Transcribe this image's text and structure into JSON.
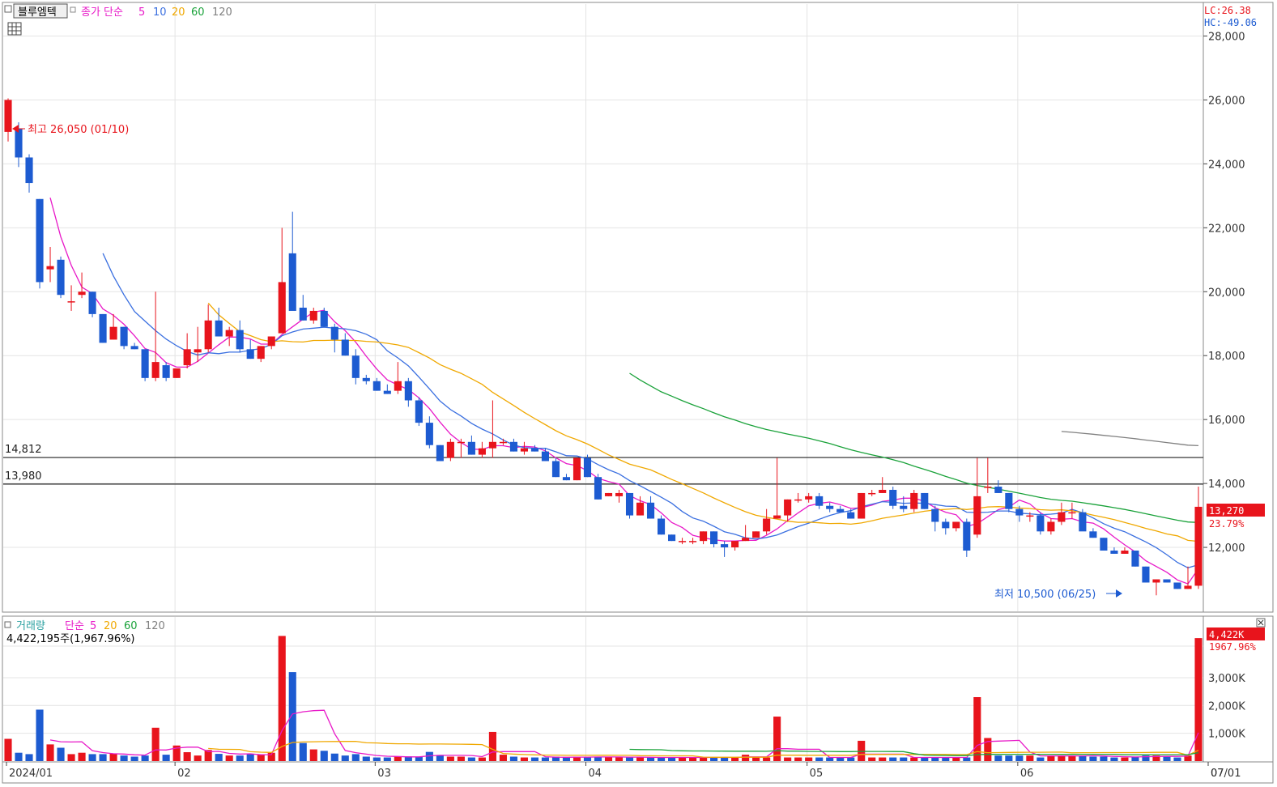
{
  "stock_name": "블루엠텍",
  "legend_price": {
    "title": "종가 단순",
    "ma": [
      {
        "label": "5",
        "color": "#e819c8"
      },
      {
        "label": "10",
        "color": "#3a6fe0"
      },
      {
        "label": "20",
        "color": "#f0a800"
      },
      {
        "label": "60",
        "color": "#1aa23a"
      },
      {
        "label": "120",
        "color": "#808080"
      }
    ]
  },
  "legend_volume": {
    "title": "거래량",
    "sub": "단순",
    "ma": [
      {
        "label": "5",
        "color": "#e819c8"
      },
      {
        "label": "20",
        "color": "#f0a800"
      },
      {
        "label": "60",
        "color": "#1aa23a"
      },
      {
        "label": "120",
        "color": "#808080"
      }
    ]
  },
  "volume_readout": "4,422,195주(1,967.96%)",
  "lc_readout": "LC:26.38",
  "hc_readout": "HC:-49.06",
  "high_annotation": "최고 26,050 (01/10)",
  "low_annotation": "최저 10,500 (06/25)",
  "hlines": [
    {
      "label": "14,812",
      "value": 14812
    },
    {
      "label": "13,980",
      "value": 13980
    }
  ],
  "current_price_label": "13,270",
  "current_change_label": "23.79%",
  "current_volume_label": "4,422K",
  "current_volume_change_label": "1967.96%",
  "colors": {
    "up": "#e8141c",
    "down": "#1d5bd1",
    "grid": "#e4e4e4"
  },
  "chart_data": {
    "type": "candlestick",
    "price_axis": {
      "ylim": [
        10000,
        29000
      ],
      "ticks": [
        {
          "value": 12000,
          "label": "12,000"
        },
        {
          "value": 14000,
          "label": "14,000"
        },
        {
          "value": 16000,
          "label": "16,000"
        },
        {
          "value": 18000,
          "label": "18,000"
        },
        {
          "value": 20000,
          "label": "20,000"
        },
        {
          "value": 22000,
          "label": "22,000"
        },
        {
          "value": 24000,
          "label": "24,000"
        },
        {
          "value": 26000,
          "label": "26,000"
        },
        {
          "value": 28000,
          "label": "28,000"
        }
      ]
    },
    "volume_axis": {
      "ylim": [
        0,
        4600
      ],
      "unit": "K",
      "ticks": [
        {
          "value": 1000,
          "label": "1,000K"
        },
        {
          "value": 2000,
          "label": "2,000K"
        },
        {
          "value": 3000,
          "label": "3,000K"
        }
      ]
    },
    "x_ticks": [
      {
        "index": 0,
        "label": "2024/01"
      },
      {
        "index": 16,
        "label": "02"
      },
      {
        "index": 35,
        "label": "03"
      },
      {
        "index": 55,
        "label": "04"
      },
      {
        "index": 76,
        "label": "05"
      },
      {
        "index": 96,
        "label": "06"
      },
      {
        "index": 115,
        "label": "07"
      },
      {
        "index": 120,
        "label": "07/01"
      }
    ],
    "candles": [
      [
        25000,
        26050,
        24700,
        26000,
        800
      ],
      [
        25100,
        25300,
        23900,
        24200,
        300
      ],
      [
        24200,
        24300,
        23100,
        23400,
        250
      ],
      [
        22900,
        22900,
        20100,
        20300,
        1850
      ],
      [
        20700,
        21400,
        20300,
        20800,
        600
      ],
      [
        21000,
        21100,
        19800,
        19900,
        480
      ],
      [
        19700,
        20200,
        19400,
        19700,
        250
      ],
      [
        19900,
        20600,
        19800,
        20000,
        300
      ],
      [
        20000,
        20000,
        19200,
        19300,
        250
      ],
      [
        19300,
        19300,
        18400,
        18400,
        250
      ],
      [
        18500,
        19300,
        18500,
        18900,
        270
      ],
      [
        18900,
        18900,
        18200,
        18300,
        200
      ],
      [
        18300,
        18400,
        18200,
        18200,
        160
      ],
      [
        18200,
        18200,
        17200,
        17300,
        200
      ],
      [
        17300,
        20000,
        17200,
        17800,
        1200
      ],
      [
        17700,
        17800,
        17200,
        17300,
        230
      ],
      [
        17300,
        17600,
        17300,
        17600,
        560
      ],
      [
        17700,
        18700,
        17600,
        18200,
        320
      ],
      [
        18100,
        18900,
        17800,
        18200,
        200
      ],
      [
        18200,
        19600,
        18100,
        19100,
        400
      ],
      [
        19100,
        19500,
        18900,
        18600,
        260
      ],
      [
        18600,
        18900,
        18300,
        18800,
        200
      ],
      [
        18800,
        19100,
        18100,
        18200,
        200
      ],
      [
        18200,
        18500,
        17900,
        17900,
        250
      ],
      [
        17900,
        18300,
        17800,
        18300,
        220
      ],
      [
        18300,
        18600,
        18200,
        18600,
        300
      ],
      [
        18700,
        22000,
        18700,
        20300,
        4500
      ],
      [
        21200,
        22500,
        19700,
        19400,
        3200
      ],
      [
        19500,
        19900,
        19100,
        19100,
        650
      ],
      [
        19100,
        19500,
        19000,
        19400,
        420
      ],
      [
        19400,
        19500,
        18900,
        18900,
        370
      ],
      [
        18900,
        19000,
        18100,
        18500,
        270
      ],
      [
        18500,
        18700,
        18000,
        18000,
        200
      ],
      [
        18000,
        18200,
        17100,
        17300,
        250
      ],
      [
        17300,
        17400,
        17100,
        17200,
        160
      ],
      [
        17200,
        17300,
        16900,
        16900,
        130
      ],
      [
        16900,
        17100,
        16800,
        16800,
        130
      ],
      [
        16900,
        17800,
        16800,
        17200,
        160
      ],
      [
        17200,
        17300,
        16400,
        16600,
        170
      ],
      [
        16600,
        16700,
        15800,
        15900,
        160
      ],
      [
        15900,
        16100,
        15100,
        15200,
        330
      ],
      [
        15200,
        15200,
        14700,
        14700,
        220
      ],
      [
        14800,
        15400,
        14700,
        15300,
        160
      ],
      [
        15300,
        15400,
        14800,
        15300,
        160
      ],
      [
        15300,
        15500,
        14900,
        14900,
        130
      ],
      [
        14900,
        15300,
        14800,
        15100,
        130
      ],
      [
        15100,
        16600,
        14800,
        15300,
        1050
      ],
      [
        15300,
        15400,
        15200,
        15300,
        230
      ],
      [
        15300,
        15400,
        15000,
        15000,
        160
      ],
      [
        15000,
        15300,
        14900,
        15100,
        130
      ],
      [
        15100,
        15200,
        15000,
        15000,
        130
      ],
      [
        15000,
        15100,
        14700,
        14700,
        130
      ],
      [
        14700,
        14800,
        14200,
        14200,
        160
      ],
      [
        14200,
        14300,
        14100,
        14100,
        130
      ],
      [
        14100,
        14800,
        14100,
        14800,
        160
      ],
      [
        14800,
        14900,
        14200,
        14200,
        130
      ],
      [
        14200,
        14300,
        13500,
        13500,
        160
      ],
      [
        13600,
        13700,
        13600,
        13700,
        160
      ],
      [
        13600,
        13800,
        13400,
        13700,
        130
      ],
      [
        13700,
        13700,
        12900,
        13000,
        130
      ],
      [
        13000,
        13600,
        13000,
        13400,
        130
      ],
      [
        13400,
        13600,
        12900,
        12900,
        130
      ],
      [
        12900,
        13000,
        12400,
        12400,
        130
      ],
      [
        12400,
        12400,
        12200,
        12200,
        130
      ],
      [
        12200,
        12300,
        12100,
        12200,
        130
      ],
      [
        12200,
        12300,
        12100,
        12200,
        130
      ],
      [
        12200,
        12500,
        12100,
        12500,
        130
      ],
      [
        12500,
        12500,
        12000,
        12100,
        130
      ],
      [
        12100,
        12200,
        11700,
        12000,
        130
      ],
      [
        12000,
        12200,
        11900,
        12200,
        130
      ],
      [
        12200,
        12700,
        12200,
        12300,
        230
      ],
      [
        12300,
        12500,
        12300,
        12500,
        130
      ],
      [
        12500,
        13200,
        12400,
        12900,
        130
      ],
      [
        12900,
        14800,
        12900,
        13000,
        1600
      ],
      [
        13000,
        13500,
        12800,
        13500,
        130
      ],
      [
        13500,
        13700,
        13400,
        13500,
        130
      ],
      [
        13500,
        13700,
        13400,
        13600,
        130
      ],
      [
        13600,
        13700,
        13200,
        13300,
        130
      ],
      [
        13300,
        13400,
        13100,
        13200,
        130
      ],
      [
        13200,
        13300,
        13100,
        13100,
        130
      ],
      [
        13100,
        13200,
        12900,
        12900,
        130
      ],
      [
        12900,
        13700,
        12900,
        13700,
        730
      ],
      [
        13700,
        13800,
        13600,
        13700,
        130
      ],
      [
        13700,
        14200,
        13700,
        13800,
        130
      ],
      [
        13800,
        13900,
        13200,
        13300,
        130
      ],
      [
        13300,
        13600,
        13100,
        13200,
        130
      ],
      [
        13200,
        13800,
        13100,
        13700,
        130
      ],
      [
        13700,
        13700,
        13200,
        13200,
        130
      ],
      [
        13200,
        13300,
        12500,
        12800,
        130
      ],
      [
        12800,
        12900,
        12400,
        12600,
        130
      ],
      [
        12600,
        12800,
        12500,
        12800,
        130
      ],
      [
        12800,
        12900,
        11700,
        11900,
        130
      ],
      [
        12400,
        14800,
        12300,
        13600,
        2300
      ],
      [
        13900,
        14800,
        13700,
        13900,
        830
      ],
      [
        13900,
        14100,
        13700,
        13700,
        200
      ],
      [
        13700,
        13700,
        13100,
        13200,
        200
      ],
      [
        13200,
        13300,
        12800,
        13000,
        200
      ],
      [
        13000,
        13100,
        12800,
        13000,
        200
      ],
      [
        13000,
        13100,
        12400,
        12500,
        130
      ],
      [
        12500,
        12900,
        12400,
        12800,
        200
      ],
      [
        12800,
        13400,
        12700,
        13100,
        200
      ],
      [
        13100,
        13400,
        12900,
        13100,
        200
      ],
      [
        13100,
        13200,
        12600,
        12500,
        200
      ],
      [
        12500,
        12600,
        12300,
        12300,
        160
      ],
      [
        12300,
        12300,
        11900,
        11900,
        160
      ],
      [
        11900,
        12000,
        11800,
        11800,
        130
      ],
      [
        11800,
        12000,
        11800,
        11900,
        130
      ],
      [
        11900,
        11900,
        11400,
        11400,
        160
      ],
      [
        11400,
        11400,
        10900,
        10900,
        200
      ],
      [
        10900,
        11000,
        10500,
        11000,
        200
      ],
      [
        11000,
        11000,
        10900,
        10900,
        160
      ],
      [
        10900,
        10900,
        10700,
        10700,
        130
      ],
      [
        10700,
        11400,
        10700,
        10800,
        200
      ],
      [
        10800,
        13900,
        10700,
        13270,
        4422
      ]
    ]
  }
}
